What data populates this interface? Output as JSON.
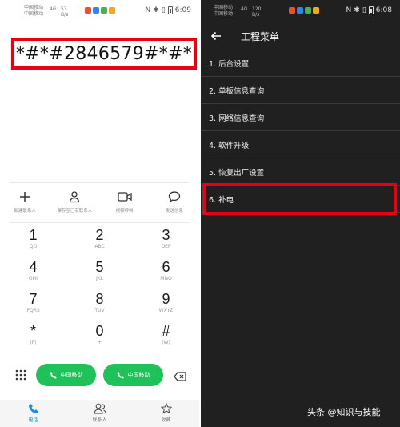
{
  "left": {
    "statusbar": {
      "carrier1": "中国移动",
      "carrier2": "中国移动",
      "signal": "4G",
      "speed": "53 B/s",
      "time": "6:09",
      "app_colors": [
        "#e8512f",
        "#2f88e8",
        "#4cb050",
        "#f5a623"
      ]
    },
    "dial_number": "*#*#2846579#*#*",
    "actions": [
      {
        "icon": "plus-icon",
        "label": "新建联系人"
      },
      {
        "icon": "person-icon",
        "label": "保存至已有联系人"
      },
      {
        "icon": "video-icon",
        "label": "视频呼叫"
      },
      {
        "icon": "message-icon",
        "label": "发送信息"
      }
    ],
    "keypad": [
      [
        {
          "d": "1",
          "l": "QD"
        },
        {
          "d": "2",
          "l": "ABC"
        },
        {
          "d": "3",
          "l": "DEF"
        }
      ],
      [
        {
          "d": "4",
          "l": "GHI"
        },
        {
          "d": "5",
          "l": "JKL"
        },
        {
          "d": "6",
          "l": "MNO"
        }
      ],
      [
        {
          "d": "7",
          "l": "PQRS"
        },
        {
          "d": "8",
          "l": "TUV"
        },
        {
          "d": "9",
          "l": "WXYZ"
        }
      ],
      [
        {
          "d": "*",
          "l": "(P)"
        },
        {
          "d": "0",
          "l": "+"
        },
        {
          "d": "#",
          "l": "(W)"
        }
      ]
    ],
    "call_buttons": [
      {
        "label": "中国移动",
        "sim": "1"
      },
      {
        "label": "中国移动",
        "sim": "2"
      }
    ],
    "bottom_nav": [
      {
        "icon": "phone-icon",
        "label": "电话",
        "active": true
      },
      {
        "icon": "contacts-icon",
        "label": "联系人",
        "active": false
      },
      {
        "icon": "star-icon",
        "label": "收藏",
        "active": false
      }
    ],
    "colors": {
      "call_green": "#1ec258",
      "highlight_red": "#e60012",
      "active_blue": "#1e88e5"
    }
  },
  "right": {
    "statusbar": {
      "carrier1": "中国移动",
      "carrier2": "中国移动",
      "signal": "4G",
      "speed": "120 B/s",
      "time": "6:08"
    },
    "title": "工程菜单",
    "menu": [
      "1. 后台设置",
      "2. 单板信息查询",
      "3. 网络信息查询",
      "4. 软件升级",
      "5. 恢复出厂设置",
      "6. 补电"
    ],
    "highlighted_index": 5,
    "colors": {
      "background": "#202020",
      "divider": "#3a3a3a"
    }
  },
  "watermark": "头条 @知识与技能"
}
